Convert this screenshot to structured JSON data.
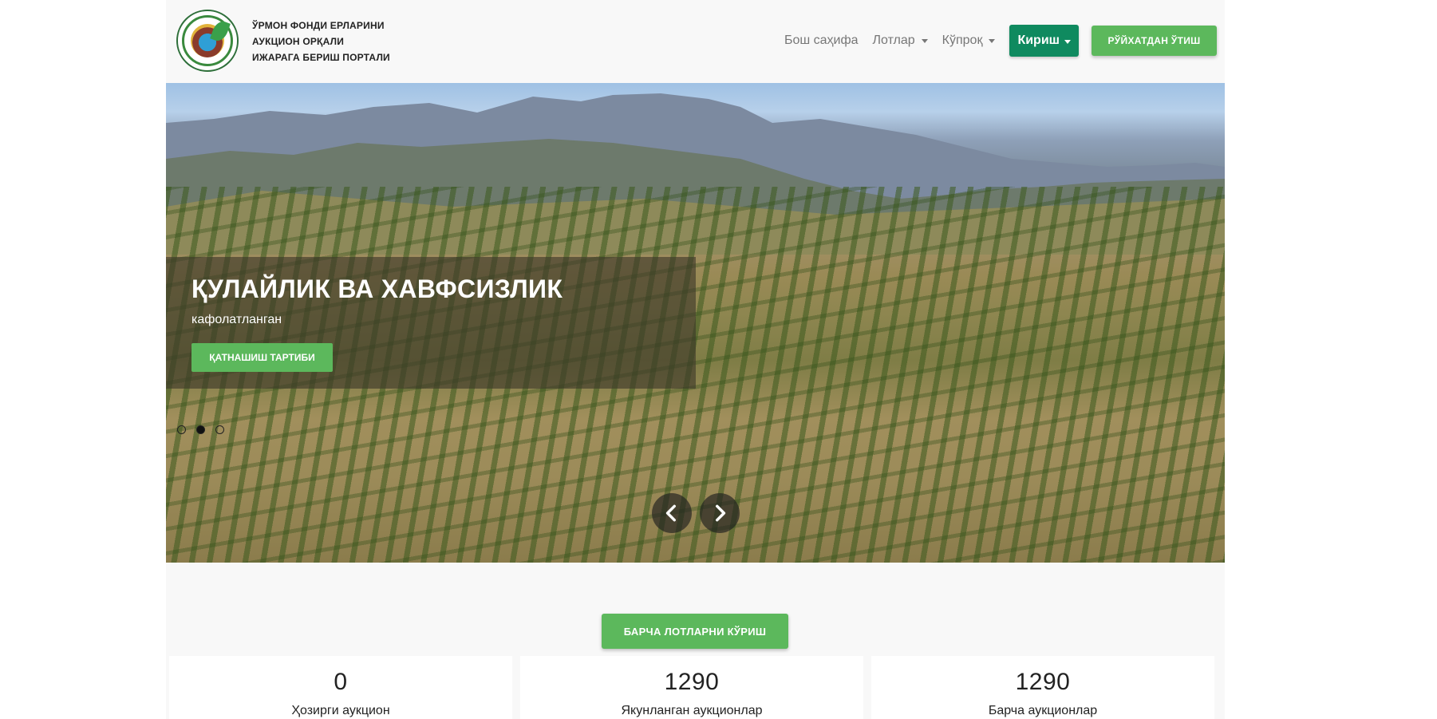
{
  "brand": {
    "line1": "ЎРМОН ФОНДИ ЕРЛАРИНИ",
    "line2": "АУКЦИОН ОРҚАЛИ",
    "line3": "ИЖАРАГА БЕРИШ ПОРТАЛИ"
  },
  "nav": {
    "home": "Бош саҳифа",
    "lots": "Лотлар",
    "more": "Кўпроқ",
    "login": "Кириш",
    "register": "РЎЙХАТДАН ЎТИШ"
  },
  "hero": {
    "title": "ҚУЛАЙЛИК ВА ХАВФСИЗЛИК",
    "subtitle": "кафолатланган",
    "button": "ҚАТНАШИШ ТАРТИБИ",
    "slides": 3,
    "active_slide": 2
  },
  "view_all": "БАРЧА ЛОТЛАРНИ КЎРИШ",
  "stats": [
    {
      "value": "0",
      "label": "Ҳозирги аукцион"
    },
    {
      "value": "1290",
      "label": "Якунланган аукционлар"
    },
    {
      "value": "1290",
      "label": "Барча аукционлар"
    }
  ],
  "colors": {
    "primary_green": "#5cb85c",
    "login_green": "#0f8a5f",
    "page_bg": "#f8f8f8"
  },
  "icons": {
    "prev": "chevron-left-icon",
    "next": "chevron-right-icon",
    "caret": "caret-down-icon"
  }
}
